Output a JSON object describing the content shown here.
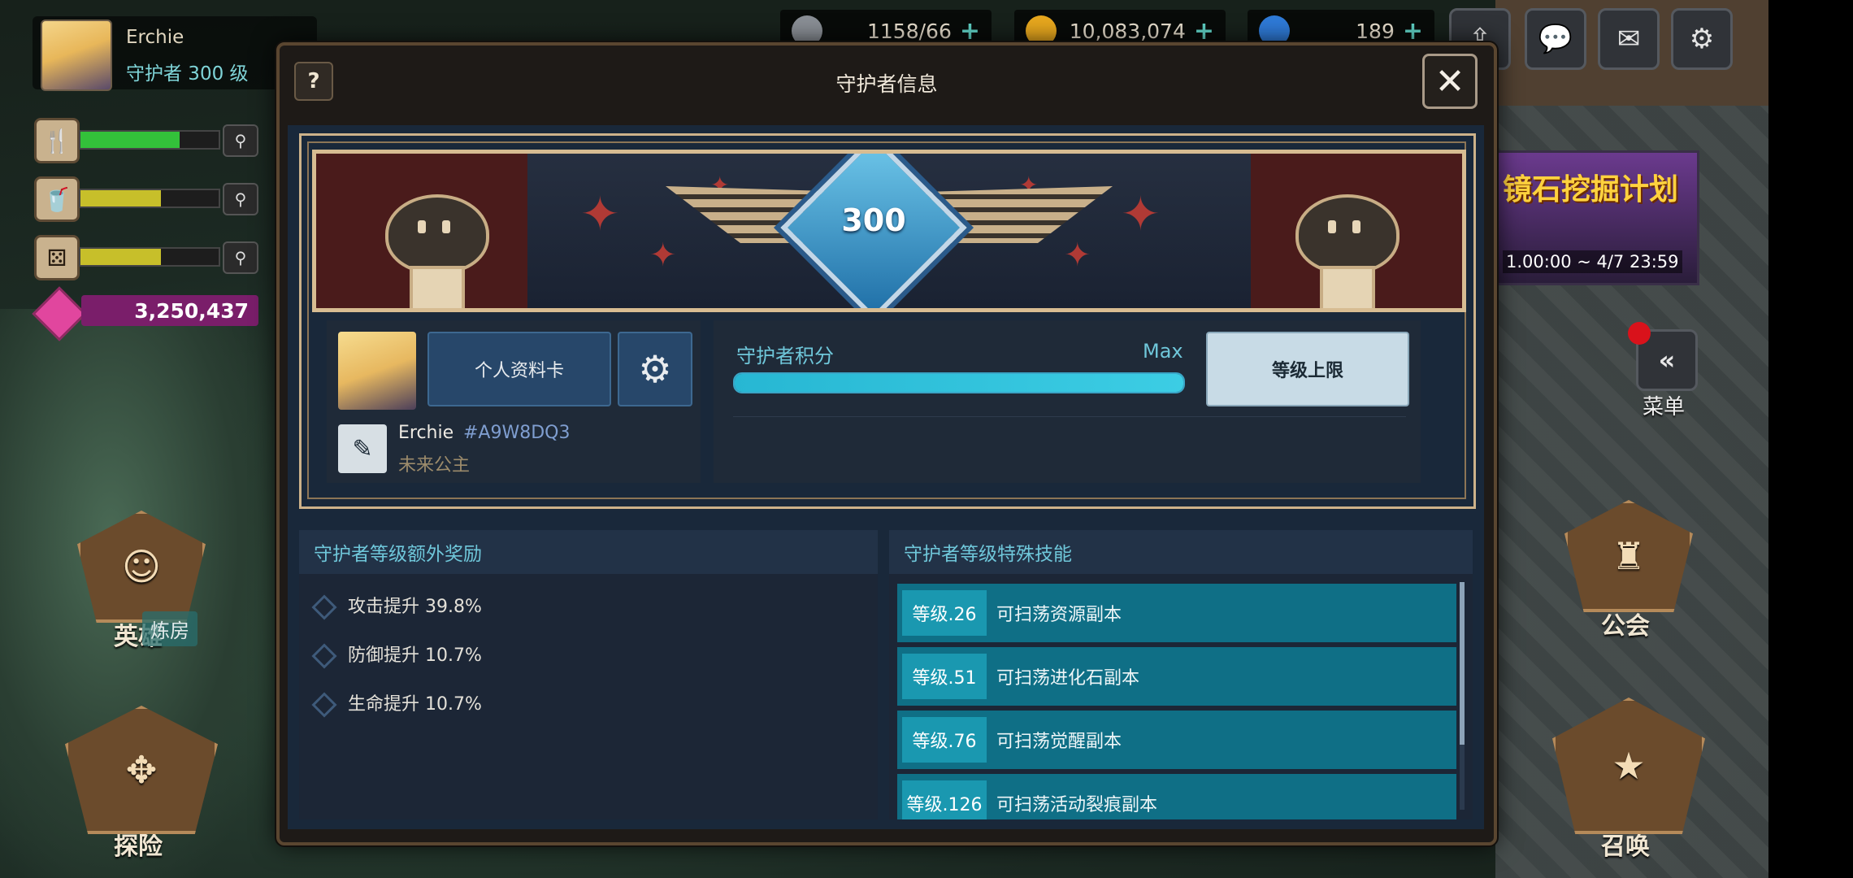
{
  "hud": {
    "player_name": "Erchie",
    "player_level": "守护者 300 级",
    "gems": "3,250,437",
    "hero_label": "英雄",
    "ribbon_label": "炼房",
    "explore_label": "探险",
    "guild_label": "公会",
    "summon_label": "召唤",
    "menu_label": "菜单",
    "stats": [
      {
        "icon": "fork-knife-icon",
        "glyph": "🍴",
        "fill": 0.72,
        "color": "#33c13a"
      },
      {
        "icon": "cup-icon",
        "glyph": "▼",
        "fill": 0.58,
        "color": "#c7bf2a"
      },
      {
        "icon": "dice-icon",
        "glyph": "⚄",
        "fill": 0.58,
        "color": "#c7bf2a"
      }
    ],
    "resources": [
      {
        "icon": "stamina-icon",
        "value": "1158/66",
        "color": "#8a8f96"
      },
      {
        "icon": "gold-coin-icon",
        "value": "10,083,074",
        "color": "#e8a81e"
      },
      {
        "icon": "crystal-icon",
        "value": "189",
        "color": "#2f7bd9"
      }
    ],
    "event": {
      "title": "镜石挖掘计划",
      "date": "1.00:00 ~ 4/7 23:59"
    }
  },
  "dialog": {
    "title": "守护者信息",
    "help": "?",
    "close": "✕",
    "level": "300",
    "profile": {
      "card_button": "个人资料卡",
      "name": "Erchie",
      "id": "#A9W8DQ3",
      "title": "未来公主"
    },
    "points": {
      "label": "守护者积分",
      "max_label": "Max",
      "progress": 1.0,
      "cap_button": "等级上限"
    },
    "bonus_panel": {
      "header": "守护者等级额外奖励",
      "items": [
        {
          "text": "攻击提升  39.8%"
        },
        {
          "text": "防御提升  10.7%"
        },
        {
          "text": "生命提升  10.7%"
        }
      ]
    },
    "skill_panel": {
      "header": "守护者等级特殊技能",
      "items": [
        {
          "level": "等级.26",
          "text": "可扫荡资源副本"
        },
        {
          "level": "等级.51",
          "text": "可扫荡进化石副本"
        },
        {
          "level": "等级.76",
          "text": "可扫荡觉醒副本"
        },
        {
          "level": "等级.126",
          "text": "可扫荡活动裂痕副本"
        }
      ]
    }
  },
  "colors": {
    "accent_teal": "#6fc7da",
    "skill_row": "#0f6f86",
    "gold_frame": "#cdb28a",
    "gem_pink": "#e1469e"
  }
}
